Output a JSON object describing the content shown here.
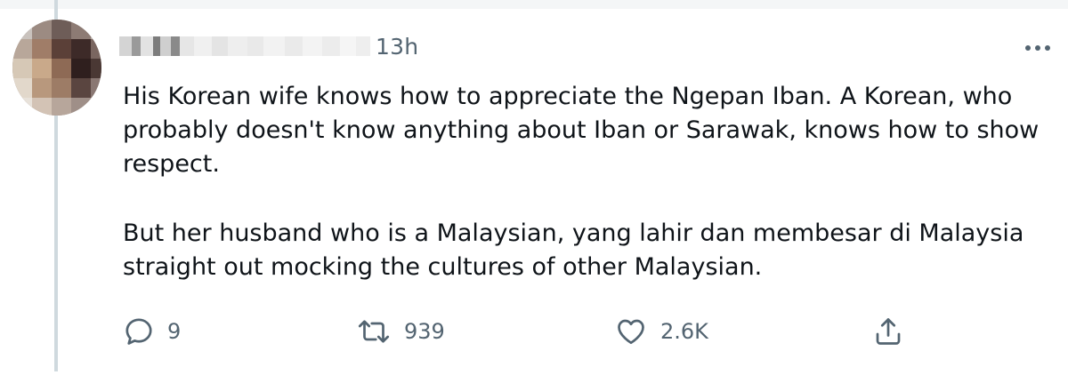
{
  "tweet": {
    "timestamp": "13h",
    "paragraphs": [
      [
        "His Korean wife knows how to appreciate the Ngepan Iban. A Korean, who",
        "probably doesn't know anything about Iban or Sarawak, knows how to show",
        "respect."
      ],
      [
        "But her husband who is a Malaysian, yang lahir dan membesar di Malaysia",
        "straight out mocking the cultures of other Malaysian."
      ]
    ]
  },
  "actions": {
    "reply": {
      "icon": "reply-icon",
      "count": "9"
    },
    "retweet": {
      "icon": "retweet-icon",
      "count": "939"
    },
    "like": {
      "icon": "heart-icon",
      "count": "2.6K"
    },
    "share": {
      "icon": "share-icon"
    }
  },
  "colors": {
    "text": "#0f1419",
    "secondary": "#536471",
    "thread_line": "#cfd9de",
    "background": "#ffffff"
  }
}
